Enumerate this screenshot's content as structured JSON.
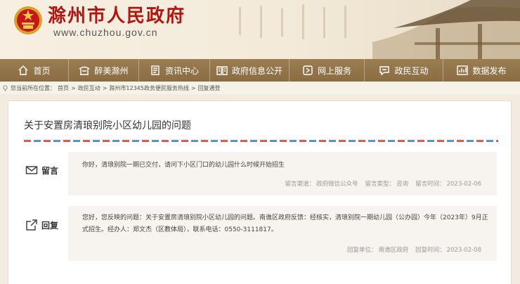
{
  "header": {
    "title": "滁州市人民政府",
    "url": "www.chuzhou.gov.cn"
  },
  "nav": [
    {
      "label": "首页",
      "icon": "home-icon"
    },
    {
      "label": "醉美滁州",
      "icon": "pavilion-icon"
    },
    {
      "label": "资讯中心",
      "icon": "news-icon"
    },
    {
      "label": "政府信息公开",
      "icon": "book-icon"
    },
    {
      "label": "网上服务",
      "icon": "service-icon"
    },
    {
      "label": "政民互动",
      "icon": "chat-icon"
    },
    {
      "label": "数据发布",
      "icon": "chart-icon"
    }
  ],
  "breadcrumb": {
    "prefix": "您当前所在位置：",
    "items": [
      "首页",
      "政民互动",
      "滁州市12345政务便民服务热线",
      "回复通登"
    ]
  },
  "article": {
    "title": "关于安置房清琅别院小区幼儿园的问题"
  },
  "message": {
    "label": "留言",
    "content": "你好，清琅别院一期已交付，请问下小区门口的幼儿园什么时候开始招生",
    "channel_label": "留言渠道：",
    "channel_value": "政府微信公众号",
    "type_label": "留言类型：",
    "type_value": "咨询",
    "time_label": "留言时间：",
    "time_value": "2023-02-06"
  },
  "reply": {
    "label": "回复",
    "content": "您好，您反映的问题：关于安置房清琅别院小区幼儿园的问题。南谯区政府反馈：经核实，清琅别院一期幼儿园（公办园）今年（2023年）9月正式招生。经办人：郑文杰（区教体局），联系电话：0550-3111817。",
    "unit_label": "回复单位：",
    "unit_value": "南谯区政府",
    "time_label": "回复时间：",
    "time_value": "2023-02-08"
  },
  "colors": {
    "brand_red": "#b3140f",
    "nav_brown": "#8a6d43",
    "stripe_red": "#e05a4f",
    "stripe_blue": "#5b8fd6"
  }
}
